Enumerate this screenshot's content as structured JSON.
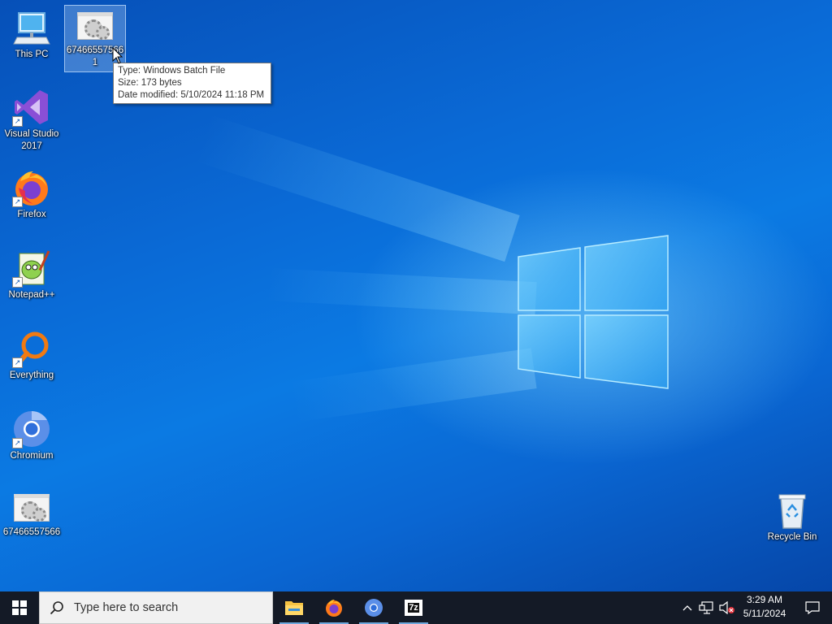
{
  "desktop": {
    "icons": [
      {
        "label": "This PC",
        "icon": "computer-icon"
      },
      {
        "label": "67466557566",
        "label2": "1",
        "icon": "batch-file-icon",
        "selected": true
      },
      {
        "label": "Visual Studio",
        "label2": "2017",
        "icon": "visual-studio-icon"
      },
      {
        "label": "Firefox",
        "icon": "firefox-icon"
      },
      {
        "label": "Notepad++",
        "icon": "notepadpp-icon"
      },
      {
        "label": "Everything",
        "icon": "everything-icon"
      },
      {
        "label": "Chromium",
        "icon": "chromium-icon"
      },
      {
        "label": "67466557566",
        "icon": "batch-file-icon"
      },
      {
        "label": "Recycle Bin",
        "icon": "recycle-bin-icon"
      }
    ],
    "tooltip": {
      "type_line": "Type: Windows Batch File",
      "size_line": "Size: 173 bytes",
      "date_line": "Date modified: 5/10/2024 11:18 PM"
    }
  },
  "taskbar": {
    "search_placeholder": "Type here to search",
    "apps": [
      {
        "name": "File Explorer",
        "icon": "folder-icon"
      },
      {
        "name": "Firefox",
        "icon": "firefox-icon"
      },
      {
        "name": "Chromium",
        "icon": "chromium-icon"
      },
      {
        "name": "7-Zip",
        "icon": "7zip-icon",
        "text": "7z"
      }
    ],
    "clock": {
      "time": "3:29 AM",
      "date": "5/11/2024"
    }
  },
  "colors": {
    "taskbar_bg": "#141a26",
    "desktop_accent": "#0a6ad6",
    "running_indicator": "#6fa8dc"
  }
}
